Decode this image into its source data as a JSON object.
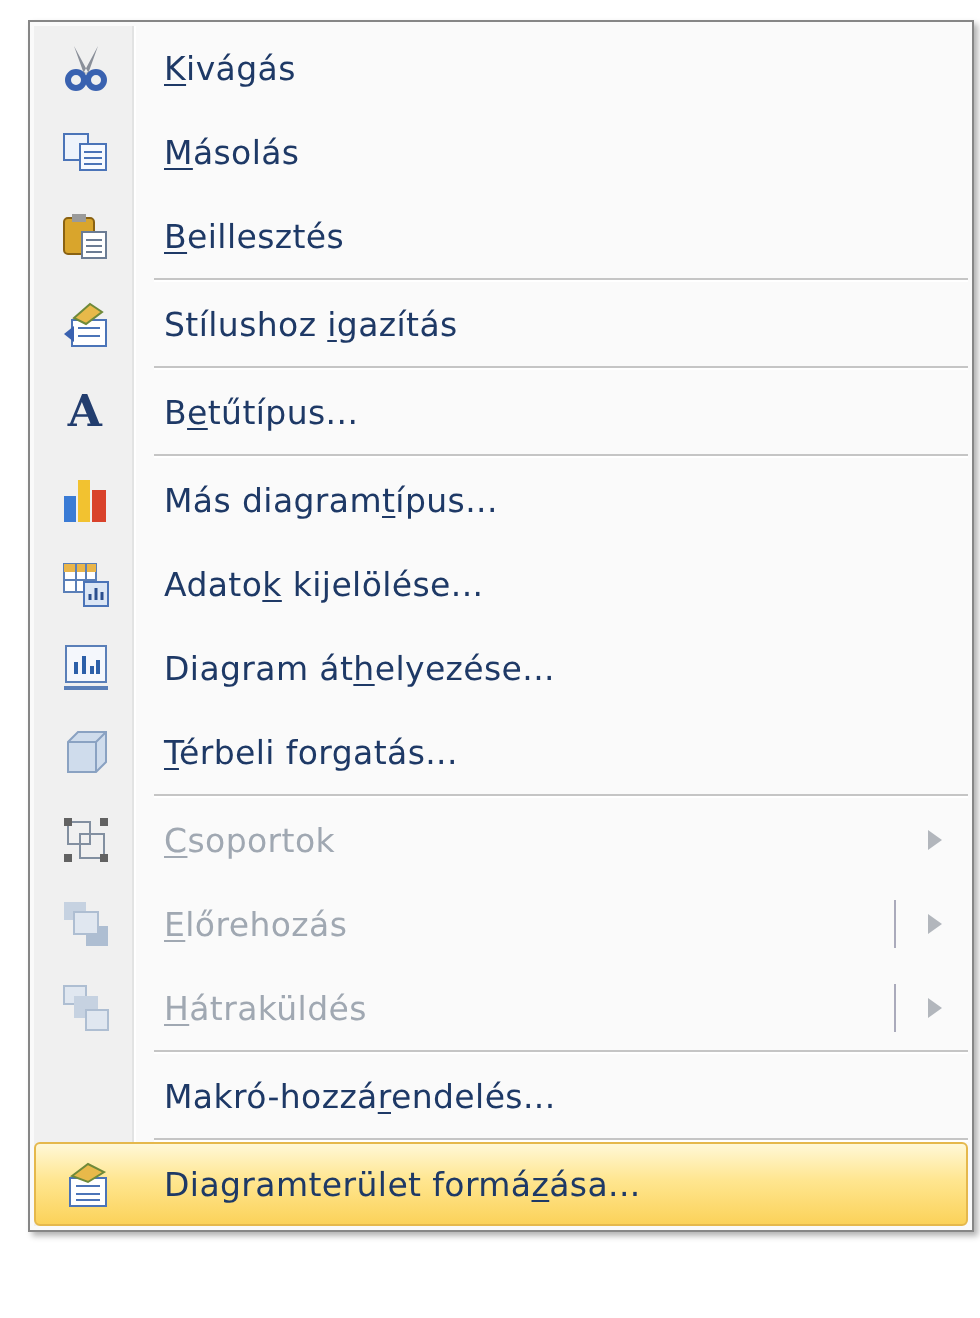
{
  "context_menu": {
    "items": [
      {
        "kind": "item",
        "hotkey": "K",
        "text_after": "ivágás",
        "disabled": false,
        "selected": false
      },
      {
        "kind": "item",
        "hotkey": "M",
        "text_after": "ásolás",
        "disabled": false,
        "selected": false
      },
      {
        "kind": "item",
        "hotkey": "B",
        "text_after": "eillesztés",
        "disabled": false,
        "selected": false
      },
      {
        "kind": "separator"
      },
      {
        "kind": "item",
        "text_before": "Stílushoz ",
        "hotkey": "i",
        "text_after": "gazítás",
        "disabled": false,
        "selected": false
      },
      {
        "kind": "separator"
      },
      {
        "kind": "item",
        "icon_text": "A",
        "text_before": "B",
        "hotkey": "e",
        "text_after": "tűtípus...",
        "disabled": false,
        "selected": false
      },
      {
        "kind": "separator"
      },
      {
        "kind": "item",
        "text_before": "Más diagram",
        "hotkey": "t",
        "text_after": "ípus...",
        "disabled": false,
        "selected": false
      },
      {
        "kind": "item",
        "text_before": "Adato",
        "hotkey": "k",
        "text_after": " kijelölése...",
        "disabled": false,
        "selected": false
      },
      {
        "kind": "item",
        "text_before": "Diagram át",
        "hotkey": "h",
        "text_after": "elyezése...",
        "disabled": false,
        "selected": false
      },
      {
        "kind": "item",
        "hotkey": "T",
        "text_after": "érbeli forgatás...",
        "disabled": false,
        "selected": false
      },
      {
        "kind": "separator"
      },
      {
        "kind": "item",
        "hotkey": "C",
        "text_after": "soportok",
        "disabled": true,
        "selected": false,
        "submenu": true,
        "split": false
      },
      {
        "kind": "item",
        "hotkey": "E",
        "text_after": "lőrehozás",
        "disabled": true,
        "selected": false,
        "submenu": true,
        "split": true
      },
      {
        "kind": "item",
        "hotkey": "H",
        "text_after": "átraküldés",
        "disabled": true,
        "selected": false,
        "submenu": true,
        "split": true
      },
      {
        "kind": "separator"
      },
      {
        "kind": "item",
        "text_before": "Makró-hozzá",
        "hotkey": "r",
        "text_after": "endelés...",
        "disabled": false,
        "selected": false
      },
      {
        "kind": "separator"
      },
      {
        "kind": "item",
        "text_before": "Diagramterület formá",
        "hotkey": "z",
        "text_after": "ása...",
        "disabled": false,
        "selected": true
      }
    ]
  }
}
